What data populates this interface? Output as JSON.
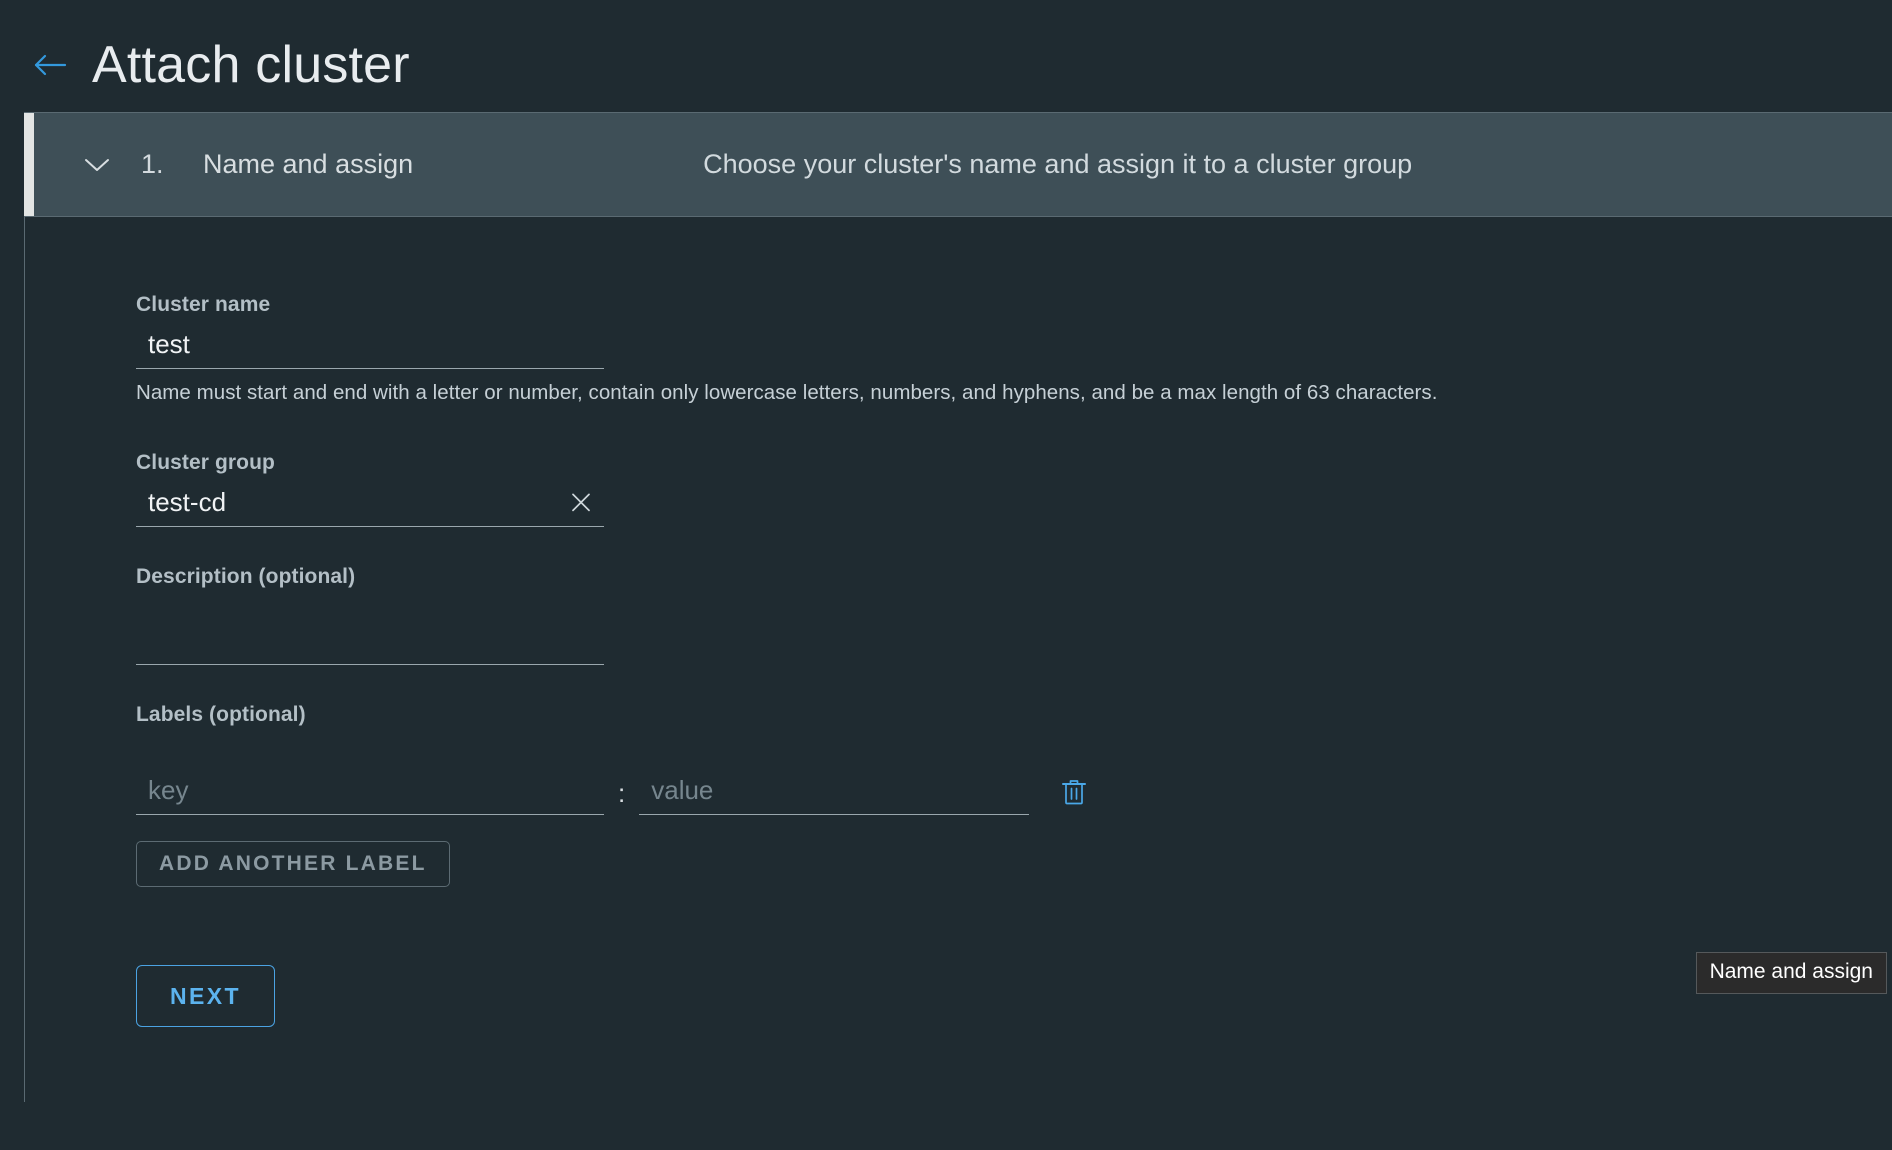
{
  "header": {
    "back_icon": "arrow-left-icon",
    "title": "Attach cluster",
    "accent_color": "#3399dd"
  },
  "wizard": {
    "step": {
      "chevron_icon": "chevron-down-icon",
      "number": "1.",
      "label": "Name and assign",
      "description": "Choose your cluster's name and assign it to a cluster group",
      "header_bg": "#3e4f57",
      "accent_bar_color": "#e3e5e4"
    }
  },
  "form": {
    "cluster_name": {
      "label": "Cluster name",
      "value": "test",
      "placeholder": "",
      "helper": "Name must start and end with a letter or number, contain only lowercase letters, numbers, and hyphens, and be a max length of 63 characters."
    },
    "cluster_group": {
      "label": "Cluster group",
      "value": "test-cd",
      "placeholder": "",
      "clear_icon": "close-icon"
    },
    "description": {
      "label": "Description (optional)",
      "value": "",
      "placeholder": ""
    },
    "labels": {
      "label": "Labels (optional)",
      "rows": [
        {
          "key_placeholder": "key",
          "key_value": "",
          "separator": ":",
          "value_placeholder": "value",
          "value_value": "",
          "delete_icon": "trash-icon"
        }
      ],
      "add_button": "ADD ANOTHER LABEL"
    },
    "next_button": "NEXT"
  },
  "tooltip": {
    "text": "Name and assign"
  }
}
